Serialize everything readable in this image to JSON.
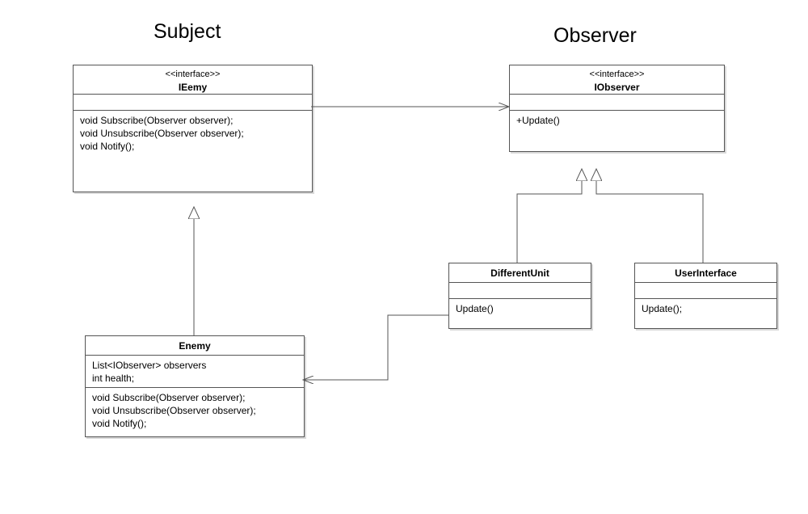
{
  "titles": {
    "subject": "Subject",
    "observer": "Observer"
  },
  "ieemy": {
    "stereotype": "<<interface>>",
    "name": "IEemy",
    "methods": [
      "void Subscribe(Observer observer);",
      "void Unsubscribe(Observer observer);",
      "void Notify();"
    ]
  },
  "iobserver": {
    "stereotype": "<<interface>>",
    "name": "IObserver",
    "methods": [
      "+Update()"
    ]
  },
  "enemy": {
    "name": "Enemy",
    "attributes": [
      "List<IObserver> observers",
      "int health;"
    ],
    "methods": [
      " void Subscribe(Observer observer);",
      " void Unsubscribe(Observer observer);",
      "void Notify();"
    ]
  },
  "different_unit": {
    "name": "DifferentUnit",
    "methods": [
      "Update()"
    ]
  },
  "user_interface": {
    "name": "UserInterface",
    "methods": [
      "Update();"
    ]
  }
}
